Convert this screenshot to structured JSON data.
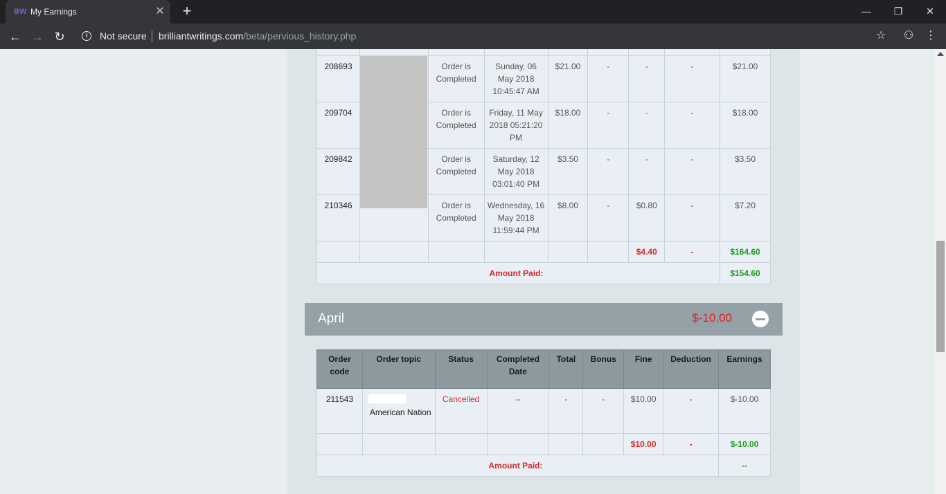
{
  "browser": {
    "tab_title": "My Earnings",
    "favicon_text": "BW",
    "security_label": "Not secure",
    "url_host": "brilliantwritings.com",
    "url_path": "/beta/pervious_history.php"
  },
  "may_table": {
    "rows": [
      {
        "code": "208693",
        "status": "Order is Completed",
        "date": "Sunday, 06 May 2018 10:45:47 AM",
        "total": "$21.00",
        "bonus": "-",
        "fine": "-",
        "deduction": "-",
        "earnings": "$21.00"
      },
      {
        "code": "209704",
        "status": "Order is Completed",
        "date": "Friday, 11 May 2018 05:21:20 PM",
        "total": "$18.00",
        "bonus": "-",
        "fine": "-",
        "deduction": "-",
        "earnings": "$18.00"
      },
      {
        "code": "209842",
        "status": "Order is Completed",
        "date": "Saturday, 12 May 2018 03:01:40 PM",
        "total": "$3.50",
        "bonus": "-",
        "fine": "-",
        "deduction": "-",
        "earnings": "$3.50"
      },
      {
        "code": "210346",
        "status": "Order is Completed",
        "date": "Wednesday, 16 May 2018 11:59:44 PM",
        "total": "$8.00",
        "bonus": "-",
        "fine": "$0.80",
        "deduction": "-",
        "earnings": "$7.20"
      }
    ],
    "totals": {
      "fine": "$4.40",
      "deduction": "-",
      "earnings": "$164.60"
    },
    "amount_paid_label": "Amount Paid:",
    "amount_paid": "$154.60"
  },
  "april": {
    "month": "April",
    "amount": "$-10.00",
    "headers": {
      "order_code": "Order code",
      "order_topic": "Order topic",
      "status": "Status",
      "completed_date": "Completed Date",
      "total": "Total",
      "bonus": "Bonus",
      "fine": "Fine",
      "deduction": "Deduction",
      "earnings": "Earnings"
    },
    "rows": [
      {
        "code": "211543",
        "topic": "American Nation",
        "status": "Cancelled",
        "date": "--",
        "total": "-",
        "bonus": "-",
        "fine": "$10.00",
        "deduction": "-",
        "earnings": "$-10.00"
      }
    ],
    "totals": {
      "fine": "$10.00",
      "deduction": "-",
      "earnings": "$-10.00"
    },
    "amount_paid_label": "Amount Paid:",
    "amount_paid": "--"
  },
  "colors": {
    "red": "#d42a2a",
    "green": "#1f9a1f",
    "header_bg": "#8c9aa0",
    "month_bar": "#94a2a8"
  }
}
